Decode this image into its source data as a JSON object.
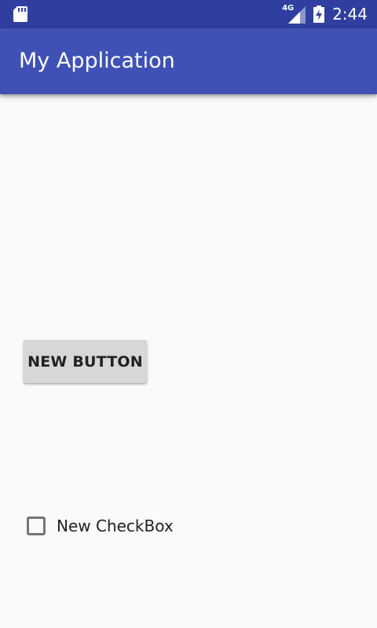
{
  "status_bar": {
    "left_icon": "sd-card-icon",
    "network_label": "4G",
    "network_icon": "cell-signal-icon",
    "battery_icon": "battery-charging-icon",
    "time": "2:44"
  },
  "app_bar": {
    "title": "My Application"
  },
  "main": {
    "button_label": "NEW BUTTON",
    "checkbox": {
      "label": "New CheckBox",
      "checked": false
    }
  },
  "colors": {
    "status_bar": "#303f9f",
    "app_bar": "#3f51b5",
    "background": "#fafafa",
    "button": "#d6d7d7"
  }
}
